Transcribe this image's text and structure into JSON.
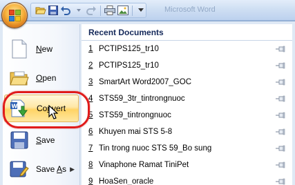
{
  "title_bar": {
    "faded_title": "Microsoft Word"
  },
  "qat": {
    "icons": [
      "folder-open-icon",
      "save-icon",
      "undo-icon",
      "redo-icon",
      "print-icon",
      "picture-icon",
      "customize-dropdown-icon"
    ]
  },
  "command_pane": {
    "items": [
      {
        "label": "New",
        "underline": "N",
        "rest": "ew"
      },
      {
        "label": "Open",
        "underline": "O",
        "rest": "pen"
      },
      {
        "label": "Convert",
        "underline": "n",
        "pre": "Co",
        "rest": "vert"
      },
      {
        "label": "Save",
        "underline": "S",
        "rest": "ave"
      },
      {
        "label": "Save As",
        "underline": "A",
        "pre": "Save ",
        "rest": "s"
      }
    ]
  },
  "recent": {
    "header": "Recent Documents",
    "items": [
      {
        "num": "1",
        "name": "PCTIPS125_tr10"
      },
      {
        "num": "2",
        "name": "PCTIPS125_tr10"
      },
      {
        "num": "3",
        "name": "SmartArt Word2007_GOC"
      },
      {
        "num": "4",
        "name": "STS59_3tr_tintrongnuoc"
      },
      {
        "num": "5",
        "name": "STS59_tintrongnuoc"
      },
      {
        "num": "6",
        "name": "Khuyen mai STS 5-8"
      },
      {
        "num": "7",
        "name": "Tin trong nuoc STS 59_Bo sung"
      },
      {
        "num": "8",
        "name": "Vinaphone Ramat TiniPet"
      },
      {
        "num": "9",
        "name": "HoaSen_oracle"
      }
    ]
  },
  "colors": {
    "highlight_ring": "#e01b1b",
    "hover_fill": "#ffd466",
    "header_text": "#15295a"
  }
}
